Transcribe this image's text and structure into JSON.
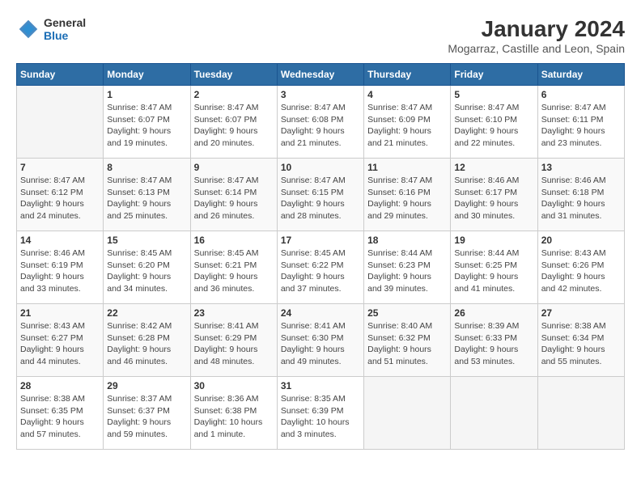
{
  "header": {
    "logo_general": "General",
    "logo_blue": "Blue",
    "title": "January 2024",
    "subtitle": "Mogarraz, Castille and Leon, Spain"
  },
  "days_of_week": [
    "Sunday",
    "Monday",
    "Tuesday",
    "Wednesday",
    "Thursday",
    "Friday",
    "Saturday"
  ],
  "weeks": [
    [
      {
        "day": "",
        "info": ""
      },
      {
        "day": "1",
        "info": "Sunrise: 8:47 AM\nSunset: 6:07 PM\nDaylight: 9 hours\nand 19 minutes."
      },
      {
        "day": "2",
        "info": "Sunrise: 8:47 AM\nSunset: 6:07 PM\nDaylight: 9 hours\nand 20 minutes."
      },
      {
        "day": "3",
        "info": "Sunrise: 8:47 AM\nSunset: 6:08 PM\nDaylight: 9 hours\nand 21 minutes."
      },
      {
        "day": "4",
        "info": "Sunrise: 8:47 AM\nSunset: 6:09 PM\nDaylight: 9 hours\nand 21 minutes."
      },
      {
        "day": "5",
        "info": "Sunrise: 8:47 AM\nSunset: 6:10 PM\nDaylight: 9 hours\nand 22 minutes."
      },
      {
        "day": "6",
        "info": "Sunrise: 8:47 AM\nSunset: 6:11 PM\nDaylight: 9 hours\nand 23 minutes."
      }
    ],
    [
      {
        "day": "7",
        "info": "Sunrise: 8:47 AM\nSunset: 6:12 PM\nDaylight: 9 hours\nand 24 minutes."
      },
      {
        "day": "8",
        "info": "Sunrise: 8:47 AM\nSunset: 6:13 PM\nDaylight: 9 hours\nand 25 minutes."
      },
      {
        "day": "9",
        "info": "Sunrise: 8:47 AM\nSunset: 6:14 PM\nDaylight: 9 hours\nand 26 minutes."
      },
      {
        "day": "10",
        "info": "Sunrise: 8:47 AM\nSunset: 6:15 PM\nDaylight: 9 hours\nand 28 minutes."
      },
      {
        "day": "11",
        "info": "Sunrise: 8:47 AM\nSunset: 6:16 PM\nDaylight: 9 hours\nand 29 minutes."
      },
      {
        "day": "12",
        "info": "Sunrise: 8:46 AM\nSunset: 6:17 PM\nDaylight: 9 hours\nand 30 minutes."
      },
      {
        "day": "13",
        "info": "Sunrise: 8:46 AM\nSunset: 6:18 PM\nDaylight: 9 hours\nand 31 minutes."
      }
    ],
    [
      {
        "day": "14",
        "info": "Sunrise: 8:46 AM\nSunset: 6:19 PM\nDaylight: 9 hours\nand 33 minutes."
      },
      {
        "day": "15",
        "info": "Sunrise: 8:45 AM\nSunset: 6:20 PM\nDaylight: 9 hours\nand 34 minutes."
      },
      {
        "day": "16",
        "info": "Sunrise: 8:45 AM\nSunset: 6:21 PM\nDaylight: 9 hours\nand 36 minutes."
      },
      {
        "day": "17",
        "info": "Sunrise: 8:45 AM\nSunset: 6:22 PM\nDaylight: 9 hours\nand 37 minutes."
      },
      {
        "day": "18",
        "info": "Sunrise: 8:44 AM\nSunset: 6:23 PM\nDaylight: 9 hours\nand 39 minutes."
      },
      {
        "day": "19",
        "info": "Sunrise: 8:44 AM\nSunset: 6:25 PM\nDaylight: 9 hours\nand 41 minutes."
      },
      {
        "day": "20",
        "info": "Sunrise: 8:43 AM\nSunset: 6:26 PM\nDaylight: 9 hours\nand 42 minutes."
      }
    ],
    [
      {
        "day": "21",
        "info": "Sunrise: 8:43 AM\nSunset: 6:27 PM\nDaylight: 9 hours\nand 44 minutes."
      },
      {
        "day": "22",
        "info": "Sunrise: 8:42 AM\nSunset: 6:28 PM\nDaylight: 9 hours\nand 46 minutes."
      },
      {
        "day": "23",
        "info": "Sunrise: 8:41 AM\nSunset: 6:29 PM\nDaylight: 9 hours\nand 48 minutes."
      },
      {
        "day": "24",
        "info": "Sunrise: 8:41 AM\nSunset: 6:30 PM\nDaylight: 9 hours\nand 49 minutes."
      },
      {
        "day": "25",
        "info": "Sunrise: 8:40 AM\nSunset: 6:32 PM\nDaylight: 9 hours\nand 51 minutes."
      },
      {
        "day": "26",
        "info": "Sunrise: 8:39 AM\nSunset: 6:33 PM\nDaylight: 9 hours\nand 53 minutes."
      },
      {
        "day": "27",
        "info": "Sunrise: 8:38 AM\nSunset: 6:34 PM\nDaylight: 9 hours\nand 55 minutes."
      }
    ],
    [
      {
        "day": "28",
        "info": "Sunrise: 8:38 AM\nSunset: 6:35 PM\nDaylight: 9 hours\nand 57 minutes."
      },
      {
        "day": "29",
        "info": "Sunrise: 8:37 AM\nSunset: 6:37 PM\nDaylight: 9 hours\nand 59 minutes."
      },
      {
        "day": "30",
        "info": "Sunrise: 8:36 AM\nSunset: 6:38 PM\nDaylight: 10 hours\nand 1 minute."
      },
      {
        "day": "31",
        "info": "Sunrise: 8:35 AM\nSunset: 6:39 PM\nDaylight: 10 hours\nand 3 minutes."
      },
      {
        "day": "",
        "info": ""
      },
      {
        "day": "",
        "info": ""
      },
      {
        "day": "",
        "info": ""
      }
    ]
  ]
}
